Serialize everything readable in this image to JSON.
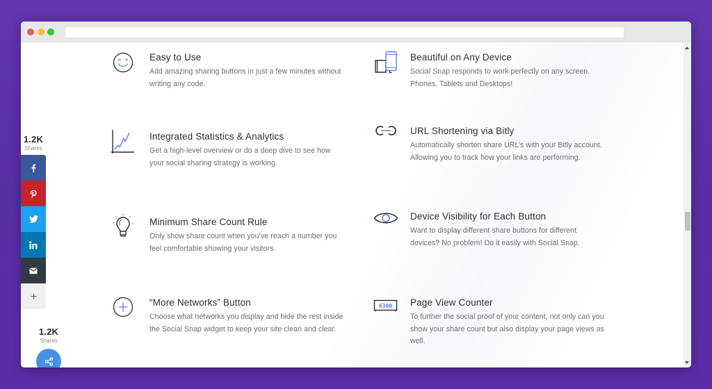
{
  "browser": {
    "url": ""
  },
  "share_sidebar": {
    "count": "1.2K",
    "count_label": "Shares",
    "buttons": [
      {
        "network": "facebook",
        "icon": "facebook-icon",
        "color": "#3b5998"
      },
      {
        "network": "pinterest",
        "icon": "pinterest-icon",
        "color": "#c8232c"
      },
      {
        "network": "twitter",
        "icon": "twitter-icon",
        "color": "#1da1f2"
      },
      {
        "network": "linkedin",
        "icon": "linkedin-icon",
        "color": "#0077b5"
      },
      {
        "network": "email",
        "icon": "envelope-icon",
        "color": "#323b43"
      },
      {
        "network": "more",
        "icon": "plus-icon",
        "color": "#f0f0f0"
      }
    ]
  },
  "floating_share": {
    "count": "1.2K",
    "count_label": "Shares",
    "button_icon": "share-icon",
    "color": "#4a90e2"
  },
  "features": [
    {
      "icon": "smiley-icon",
      "title": "Easy to Use",
      "description": "Add amazing sharing buttons in just a few minutes without writing any code."
    },
    {
      "icon": "devices-icon",
      "title": "Beautiful on Any Device",
      "description": "Social Snap responds to work perfectly on any screen. Phones, Tablets and Desktops!"
    },
    {
      "icon": "chart-icon",
      "title": "Integrated Statistics & Analytics",
      "description": "Get a high-level overview or do a deep dive to see how your social sharing strategy is working."
    },
    {
      "icon": "link-icon",
      "title": "URL Shortening via Bitly",
      "description": "Automatically shorten share URL’s with your Bitly account. Allowing you to track how your links are performing."
    },
    {
      "icon": "lightbulb-icon",
      "title": "Minimum Share Count Rule",
      "description": "Only show share count when you’ve reach a number you feel comfortable showing your visitors."
    },
    {
      "icon": "eye-icon",
      "title": "Device Visibility for Each Button",
      "description": "Want to display different share buttons for different devices? No problem! Do it easily with Social Snap."
    },
    {
      "icon": "plus-circle-icon",
      "title": "“More Networks” Button",
      "description": "Choose what networks you display and hide the rest inside the Social Snap widget to keep your site clean and clear."
    },
    {
      "icon": "counter-display-icon",
      "title": "Page View Counter",
      "description": "To further the social proof of your content, not only can you show your share count but also display your page views as well.",
      "counter_value": "6300"
    }
  ],
  "colors": {
    "background": "#5b2ea8",
    "icon_accent": "#5b7fe0",
    "icon_stroke": "#2a2a33"
  }
}
